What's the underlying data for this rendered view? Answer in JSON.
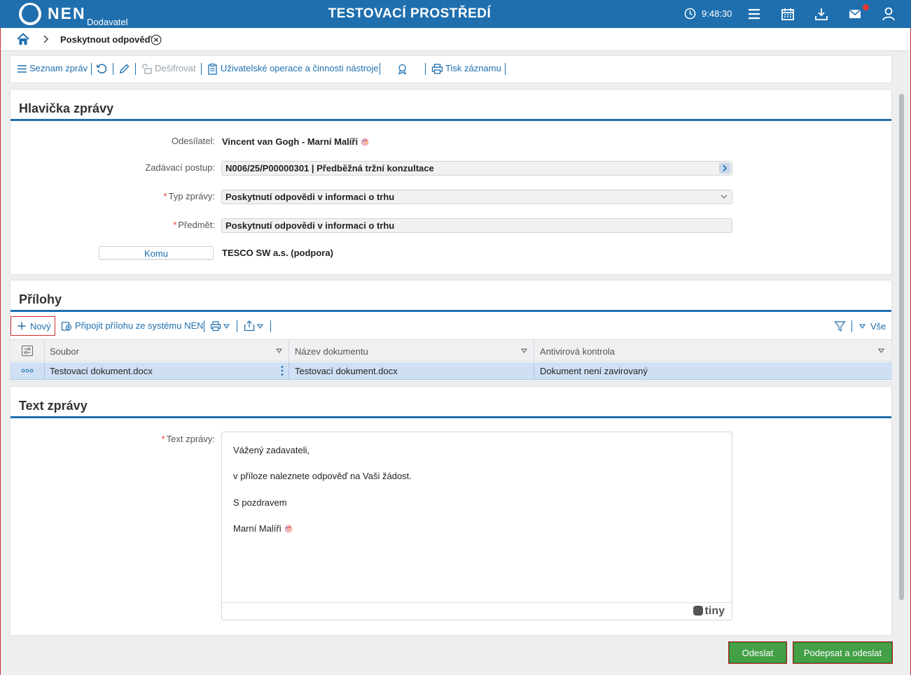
{
  "header": {
    "brand": "NEN",
    "role": "Dodavatel",
    "environment": "TESTOVACÍ PROSTŘEDÍ",
    "time": "9:48:30",
    "accent_color": "#1f6fae",
    "icons": [
      "clock-icon",
      "menu-icon",
      "calendar-icon",
      "download-icon",
      "mail-icon",
      "user-icon"
    ]
  },
  "breadcrumb": {
    "current": "Poskytnout odpověď"
  },
  "toolbar": {
    "message_list": "Seznam zpráv",
    "decrypt": "Dešifrovat",
    "user_operations": "Uživatelské operace a činnosti nástroje",
    "print_record": "Tisk záznamu"
  },
  "header_section": {
    "title": "Hlavička zprávy",
    "sender_label": "Odesílatel:",
    "sender_value": "Vincent van Gogh - Marní Malíři",
    "procedure_label": "Zadávací postup:",
    "procedure_value": "N006/25/P00000301 | Předběžná tržní konzultace",
    "type_label": "Typ zprávy:",
    "type_value": "Poskytnutí odpovědi v informaci o trhu",
    "subject_label": "Předmět:",
    "subject_value": "Poskytnutí odpovědi v informaci o trhu",
    "recipient_button": "Komu",
    "recipient_value": "TESCO SW a.s. (podpora)",
    "required_mark": "*"
  },
  "attachments": {
    "title": "Přílohy",
    "new_button": "Nový",
    "attach_from_system": "Připojit přílohu ze systému NEN",
    "filter_all": "Vše",
    "columns": [
      "Soubor",
      "Název dokumentu",
      "Antivirová kontrola"
    ],
    "rows": [
      {
        "file": "Testovací dokument.docx",
        "name": "Testovací dokument.docx",
        "antivirus": "Dokument není zavirovaný"
      }
    ]
  },
  "message": {
    "title": "Text zprávy",
    "label": "Text zprávy:",
    "lines": [
      "Vážený zadavateli,",
      "v příloze naleznete odpověď na Vaši žádost.",
      "S pozdravem",
      "Marní Malíři"
    ],
    "editor_brand": "tiny"
  },
  "actions": {
    "send": "Odeslat",
    "sign_and_send": "Podepsat a odeslat"
  }
}
